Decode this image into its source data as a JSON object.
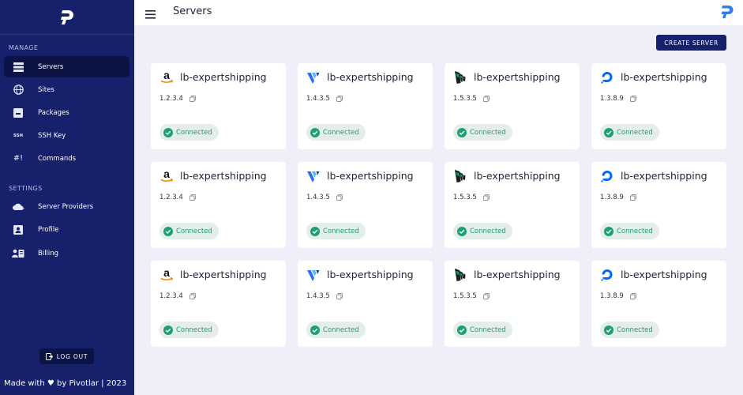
{
  "app": {
    "page_title": "Servers"
  },
  "sidebar": {
    "sections": [
      {
        "title": "MANAGE"
      },
      {
        "title": "SETTINGS"
      }
    ],
    "items": [
      {
        "label": "Servers",
        "icon": "servers-icon"
      },
      {
        "label": "Sites",
        "icon": "globe-icon"
      },
      {
        "label": "Packages",
        "icon": "package-icon"
      },
      {
        "label": "SSH Key",
        "icon": "ssh-icon",
        "icon_text": "SSH"
      },
      {
        "label": "Commands",
        "icon": "terminal-icon",
        "icon_text": "#!"
      },
      {
        "label": "Server Providers",
        "icon": "cloud-add-icon"
      },
      {
        "label": "Profile",
        "icon": "profile-icon"
      },
      {
        "label": "Billing",
        "icon": "billing-icon"
      }
    ],
    "logout_label": "LOG OUT",
    "footer_prefix": "Made with",
    "footer_suffix": "by Pivotlar | 2023"
  },
  "toolbar": {
    "create_label": "CREATE SERVER"
  },
  "servers": [
    {
      "provider": "amazon-icon",
      "name": "lb-expertshipping",
      "ip": "1.2.3.4",
      "status": "Connected"
    },
    {
      "provider": "vultr-icon",
      "name": "lb-expertshipping",
      "ip": "1.4.3.5",
      "status": "Connected"
    },
    {
      "provider": "linode-icon",
      "name": "lb-expertshipping",
      "ip": "1.5.3.5",
      "status": "Connected"
    },
    {
      "provider": "digitalocean-icon",
      "name": "lb-expertshipping",
      "ip": "1.3.8.9",
      "status": "Connected"
    },
    {
      "provider": "amazon-icon",
      "name": "lb-expertshipping",
      "ip": "1.2.3.4",
      "status": "Connected"
    },
    {
      "provider": "vultr-icon",
      "name": "lb-expertshipping",
      "ip": "1.4.3.5",
      "status": "Connected"
    },
    {
      "provider": "linode-icon",
      "name": "lb-expertshipping",
      "ip": "1.5.3.5",
      "status": "Connected"
    },
    {
      "provider": "digitalocean-icon",
      "name": "lb-expertshipping",
      "ip": "1.3.8.9",
      "status": "Connected"
    },
    {
      "provider": "amazon-icon",
      "name": "lb-expertshipping",
      "ip": "1.2.3.4",
      "status": "Connected"
    },
    {
      "provider": "vultr-icon",
      "name": "lb-expertshipping",
      "ip": "1.4.3.5",
      "status": "Connected"
    },
    {
      "provider": "linode-icon",
      "name": "lb-expertshipping",
      "ip": "1.5.3.5",
      "status": "Connected"
    },
    {
      "provider": "digitalocean-icon",
      "name": "lb-expertshipping",
      "ip": "1.3.8.9",
      "status": "Connected"
    }
  ],
  "colors": {
    "sidebar": "#16206b",
    "accent": "#2e7cf6",
    "connected": "#1e9e74"
  }
}
